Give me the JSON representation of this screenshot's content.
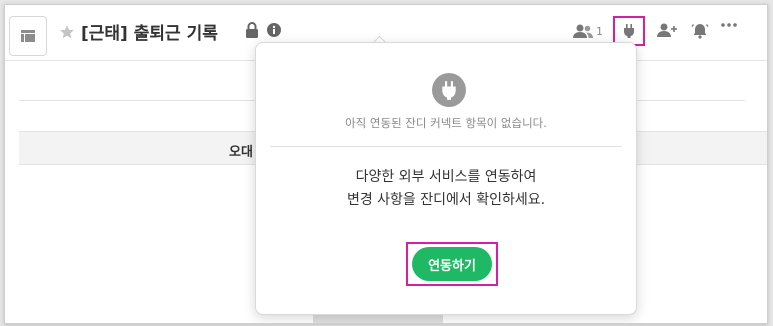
{
  "header": {
    "title": "[근태] 출퇴근 기록",
    "member_count": "1",
    "accent_highlight": "#d61fa8"
  },
  "table": {
    "column_label": "오대"
  },
  "connector_popover": {
    "empty_message": "아직 연동된 잔디 커넥트 항목이 없습니다.",
    "description_line1": "다양한 외부 서비스를 연동하여",
    "description_line2": "변경 사항을 잔디에서 확인하세요.",
    "cta_label": "연동하기",
    "cta_color": "#1fb965"
  },
  "icons": {
    "layout": "layout-icon",
    "star": "star-icon",
    "lock": "lock-icon",
    "info": "info-icon",
    "members": "members-icon",
    "connect": "plug-icon",
    "add_member": "add-member-icon",
    "alarm": "bell-icon",
    "more": "more-icon"
  }
}
